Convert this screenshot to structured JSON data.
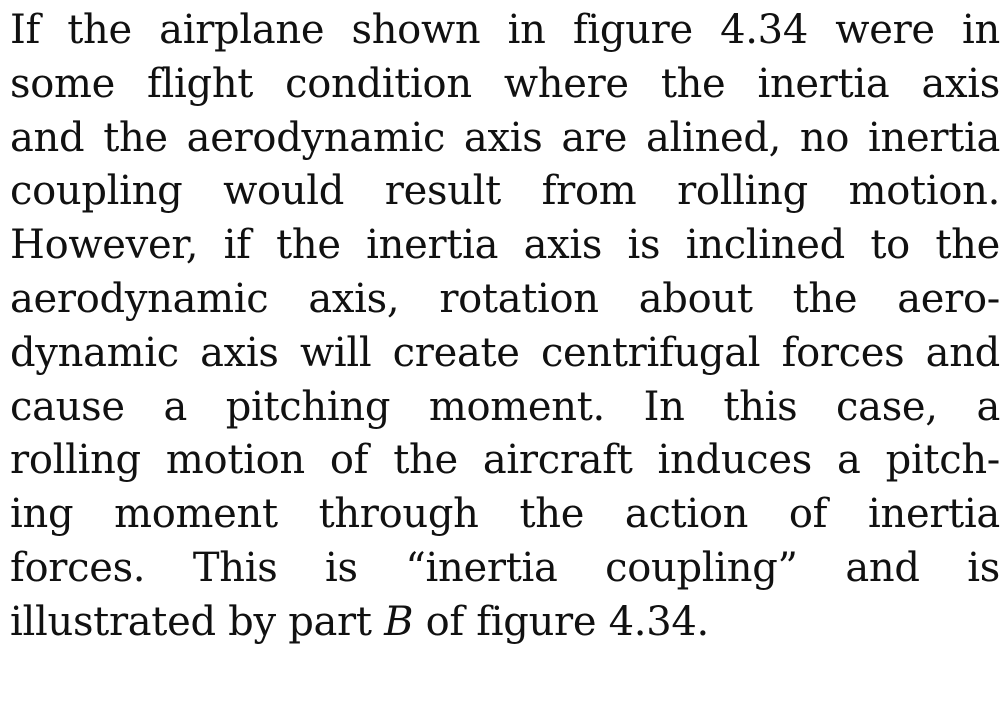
{
  "document": {
    "lines": [
      "If the airplane shown in figure 4.34 were in",
      "some flight condition where the inertia axis",
      "and the aerodynamic axis are alined, no inertia",
      "coupling would result from rolling motion.",
      "However, if the inertia axis is inclined to the",
      "aerodynamic axis, rotation about the aero-",
      "dynamic axis will create centrifugal forces and",
      "cause a pitching moment. In this case, a",
      "rolling motion of the aircraft induces a pitch-",
      "ing moment through the action of inertia",
      "forces. This is “inertia coupling” and is"
    ],
    "last_line": {
      "before": "illustrated by part ",
      "italic": "B",
      "after": " of figure 4.34."
    }
  }
}
